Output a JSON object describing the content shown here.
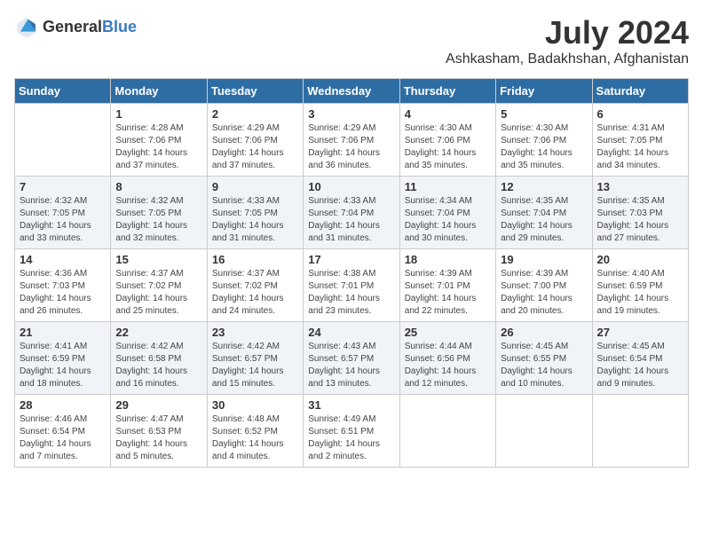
{
  "header": {
    "logo": {
      "general": "General",
      "blue": "Blue"
    },
    "title": "July 2024",
    "location": "Ashkasham, Badakhshan, Afghanistan"
  },
  "weekdays": [
    "Sunday",
    "Monday",
    "Tuesday",
    "Wednesday",
    "Thursday",
    "Friday",
    "Saturday"
  ],
  "weeks": [
    [
      {
        "day": "",
        "sunrise": "",
        "sunset": "",
        "daylight": ""
      },
      {
        "day": "1",
        "sunrise": "Sunrise: 4:28 AM",
        "sunset": "Sunset: 7:06 PM",
        "daylight": "Daylight: 14 hours and 37 minutes."
      },
      {
        "day": "2",
        "sunrise": "Sunrise: 4:29 AM",
        "sunset": "Sunset: 7:06 PM",
        "daylight": "Daylight: 14 hours and 37 minutes."
      },
      {
        "day": "3",
        "sunrise": "Sunrise: 4:29 AM",
        "sunset": "Sunset: 7:06 PM",
        "daylight": "Daylight: 14 hours and 36 minutes."
      },
      {
        "day": "4",
        "sunrise": "Sunrise: 4:30 AM",
        "sunset": "Sunset: 7:06 PM",
        "daylight": "Daylight: 14 hours and 35 minutes."
      },
      {
        "day": "5",
        "sunrise": "Sunrise: 4:30 AM",
        "sunset": "Sunset: 7:06 PM",
        "daylight": "Daylight: 14 hours and 35 minutes."
      },
      {
        "day": "6",
        "sunrise": "Sunrise: 4:31 AM",
        "sunset": "Sunset: 7:05 PM",
        "daylight": "Daylight: 14 hours and 34 minutes."
      }
    ],
    [
      {
        "day": "7",
        "sunrise": "Sunrise: 4:32 AM",
        "sunset": "Sunset: 7:05 PM",
        "daylight": "Daylight: 14 hours and 33 minutes."
      },
      {
        "day": "8",
        "sunrise": "Sunrise: 4:32 AM",
        "sunset": "Sunset: 7:05 PM",
        "daylight": "Daylight: 14 hours and 32 minutes."
      },
      {
        "day": "9",
        "sunrise": "Sunrise: 4:33 AM",
        "sunset": "Sunset: 7:05 PM",
        "daylight": "Daylight: 14 hours and 31 minutes."
      },
      {
        "day": "10",
        "sunrise": "Sunrise: 4:33 AM",
        "sunset": "Sunset: 7:04 PM",
        "daylight": "Daylight: 14 hours and 31 minutes."
      },
      {
        "day": "11",
        "sunrise": "Sunrise: 4:34 AM",
        "sunset": "Sunset: 7:04 PM",
        "daylight": "Daylight: 14 hours and 30 minutes."
      },
      {
        "day": "12",
        "sunrise": "Sunrise: 4:35 AM",
        "sunset": "Sunset: 7:04 PM",
        "daylight": "Daylight: 14 hours and 29 minutes."
      },
      {
        "day": "13",
        "sunrise": "Sunrise: 4:35 AM",
        "sunset": "Sunset: 7:03 PM",
        "daylight": "Daylight: 14 hours and 27 minutes."
      }
    ],
    [
      {
        "day": "14",
        "sunrise": "Sunrise: 4:36 AM",
        "sunset": "Sunset: 7:03 PM",
        "daylight": "Daylight: 14 hours and 26 minutes."
      },
      {
        "day": "15",
        "sunrise": "Sunrise: 4:37 AM",
        "sunset": "Sunset: 7:02 PM",
        "daylight": "Daylight: 14 hours and 25 minutes."
      },
      {
        "day": "16",
        "sunrise": "Sunrise: 4:37 AM",
        "sunset": "Sunset: 7:02 PM",
        "daylight": "Daylight: 14 hours and 24 minutes."
      },
      {
        "day": "17",
        "sunrise": "Sunrise: 4:38 AM",
        "sunset": "Sunset: 7:01 PM",
        "daylight": "Daylight: 14 hours and 23 minutes."
      },
      {
        "day": "18",
        "sunrise": "Sunrise: 4:39 AM",
        "sunset": "Sunset: 7:01 PM",
        "daylight": "Daylight: 14 hours and 22 minutes."
      },
      {
        "day": "19",
        "sunrise": "Sunrise: 4:39 AM",
        "sunset": "Sunset: 7:00 PM",
        "daylight": "Daylight: 14 hours and 20 minutes."
      },
      {
        "day": "20",
        "sunrise": "Sunrise: 4:40 AM",
        "sunset": "Sunset: 6:59 PM",
        "daylight": "Daylight: 14 hours and 19 minutes."
      }
    ],
    [
      {
        "day": "21",
        "sunrise": "Sunrise: 4:41 AM",
        "sunset": "Sunset: 6:59 PM",
        "daylight": "Daylight: 14 hours and 18 minutes."
      },
      {
        "day": "22",
        "sunrise": "Sunrise: 4:42 AM",
        "sunset": "Sunset: 6:58 PM",
        "daylight": "Daylight: 14 hours and 16 minutes."
      },
      {
        "day": "23",
        "sunrise": "Sunrise: 4:42 AM",
        "sunset": "Sunset: 6:57 PM",
        "daylight": "Daylight: 14 hours and 15 minutes."
      },
      {
        "day": "24",
        "sunrise": "Sunrise: 4:43 AM",
        "sunset": "Sunset: 6:57 PM",
        "daylight": "Daylight: 14 hours and 13 minutes."
      },
      {
        "day": "25",
        "sunrise": "Sunrise: 4:44 AM",
        "sunset": "Sunset: 6:56 PM",
        "daylight": "Daylight: 14 hours and 12 minutes."
      },
      {
        "day": "26",
        "sunrise": "Sunrise: 4:45 AM",
        "sunset": "Sunset: 6:55 PM",
        "daylight": "Daylight: 14 hours and 10 minutes."
      },
      {
        "day": "27",
        "sunrise": "Sunrise: 4:45 AM",
        "sunset": "Sunset: 6:54 PM",
        "daylight": "Daylight: 14 hours and 9 minutes."
      }
    ],
    [
      {
        "day": "28",
        "sunrise": "Sunrise: 4:46 AM",
        "sunset": "Sunset: 6:54 PM",
        "daylight": "Daylight: 14 hours and 7 minutes."
      },
      {
        "day": "29",
        "sunrise": "Sunrise: 4:47 AM",
        "sunset": "Sunset: 6:53 PM",
        "daylight": "Daylight: 14 hours and 5 minutes."
      },
      {
        "day": "30",
        "sunrise": "Sunrise: 4:48 AM",
        "sunset": "Sunset: 6:52 PM",
        "daylight": "Daylight: 14 hours and 4 minutes."
      },
      {
        "day": "31",
        "sunrise": "Sunrise: 4:49 AM",
        "sunset": "Sunset: 6:51 PM",
        "daylight": "Daylight: 14 hours and 2 minutes."
      },
      {
        "day": "",
        "sunrise": "",
        "sunset": "",
        "daylight": ""
      },
      {
        "day": "",
        "sunrise": "",
        "sunset": "",
        "daylight": ""
      },
      {
        "day": "",
        "sunrise": "",
        "sunset": "",
        "daylight": ""
      }
    ]
  ]
}
